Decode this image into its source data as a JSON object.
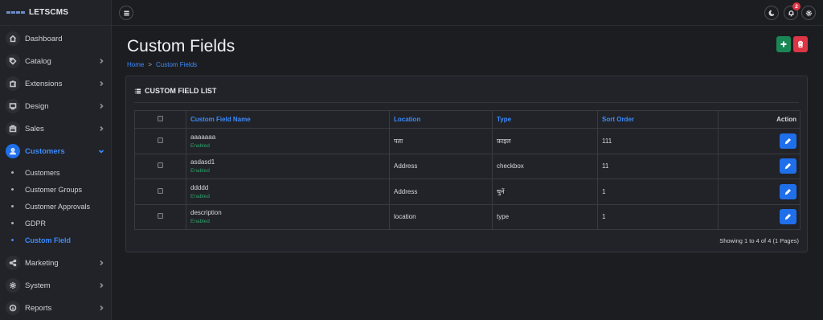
{
  "brand": {
    "name": "LETSCMS"
  },
  "sidebar": {
    "items": [
      {
        "label": "Dashboard",
        "icon": "home-icon",
        "has_children": false
      },
      {
        "label": "Catalog",
        "icon": "tag-icon",
        "has_children": true
      },
      {
        "label": "Extensions",
        "icon": "puzzle-icon",
        "has_children": true
      },
      {
        "label": "Design",
        "icon": "monitor-icon",
        "has_children": true
      },
      {
        "label": "Sales",
        "icon": "store-icon",
        "has_children": true
      },
      {
        "label": "Customers",
        "icon": "user-icon",
        "has_children": true,
        "active": true
      },
      {
        "label": "Marketing",
        "icon": "share-icon",
        "has_children": true
      },
      {
        "label": "System",
        "icon": "gear-icon",
        "has_children": true
      },
      {
        "label": "Reports",
        "icon": "info-icon",
        "has_children": true
      }
    ],
    "customers_submenu": [
      {
        "label": "Customers"
      },
      {
        "label": "Customer Groups"
      },
      {
        "label": "Customer Approvals"
      },
      {
        "label": "GDPR"
      },
      {
        "label": "Custom Field",
        "active": true
      }
    ]
  },
  "topbar": {
    "notification_count": "2"
  },
  "page": {
    "title": "Custom Fields",
    "breadcrumb": [
      "Home",
      "Custom Fields"
    ],
    "breadcrumb_sep": ">"
  },
  "card": {
    "title": "CUSTOM FIELD LIST",
    "columns": {
      "name": "Custom Field Name",
      "location": "Location",
      "type": "Type",
      "sort_order": "Sort Order",
      "action": "Action"
    },
    "rows": [
      {
        "name": "aaaaaaa",
        "status": "Enabled",
        "location": "पता",
        "type": "फ़ाइल",
        "sort_order": "111"
      },
      {
        "name": "asdasd1",
        "status": "Enabled",
        "location": "Address",
        "type": "checkbox",
        "sort_order": "11"
      },
      {
        "name": "ddddd",
        "status": "Enabled",
        "location": "Address",
        "type": "चुनें",
        "sort_order": "1"
      },
      {
        "name": "description",
        "status": "Enabled",
        "location": "location",
        "type": "type",
        "sort_order": "1"
      }
    ],
    "pagination": "Showing 1 to 4 of 4 (1 Pages)"
  },
  "colors": {
    "accent": "#1f6feb",
    "link": "#3d8bfd",
    "success": "#198754",
    "danger": "#dc3545",
    "enabled_text": "#2fa06a"
  }
}
